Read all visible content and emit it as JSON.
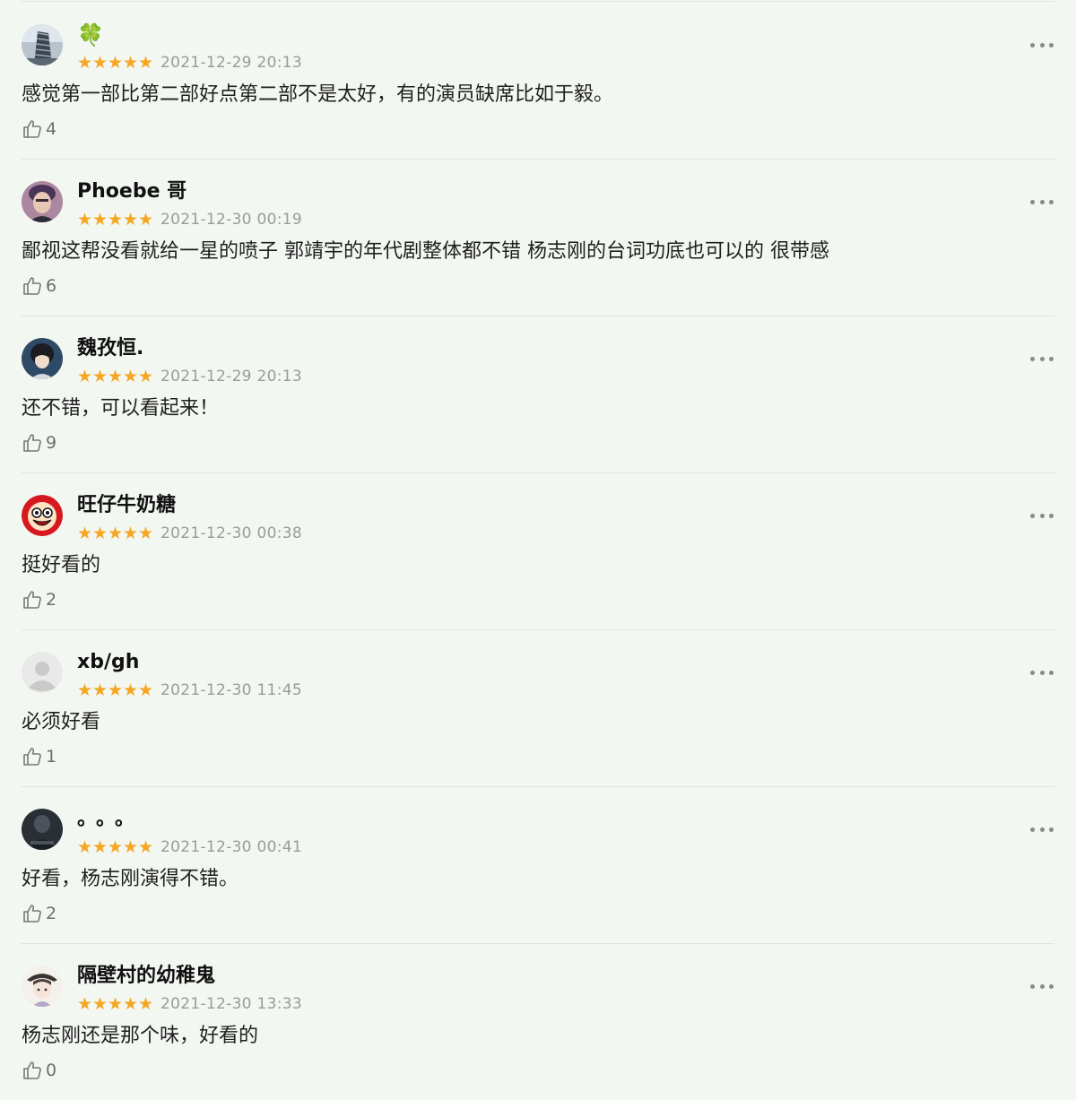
{
  "comments": [
    {
      "username": "🍀",
      "rating": 5,
      "time": "2021-12-29 20:13",
      "text": "感觉第一部比第二部好点第二部不是太好，有的演员缺席比如于毅。",
      "likes": "4"
    },
    {
      "username": "Phoebe 哥",
      "rating": 5,
      "time": "2021-12-30 00:19",
      "text": "鄙视这帮没看就给一星的喷子 郭靖宇的年代剧整体都不错 杨志刚的台词功底也可以的 很带感",
      "likes": "6"
    },
    {
      "username": "魏孜恒.",
      "rating": 5,
      "time": "2021-12-29 20:13",
      "text": "还不错，可以看起来！",
      "likes": "9"
    },
    {
      "username": "旺仔牛奶糖",
      "rating": 5,
      "time": "2021-12-30 00:38",
      "text": "挺好看的",
      "likes": "2"
    },
    {
      "username": "xb/gh",
      "rating": 5,
      "time": "2021-12-30 11:45",
      "text": "必须好看",
      "likes": "1"
    },
    {
      "username": "。。。",
      "rating": 5,
      "time": "2021-12-30 00:41",
      "text": "好看，杨志刚演得不错。",
      "likes": "2"
    },
    {
      "username": "隔壁村的幼稚鬼",
      "rating": 5,
      "time": "2021-12-30 13:33",
      "text": "杨志刚还是那个味，好看的",
      "likes": "0"
    }
  ],
  "icons": {
    "star": "★",
    "like": "thumbs-up-icon",
    "more": "more-horizontal-icon"
  },
  "colors": {
    "background": "#f3f7f2",
    "star": "#f5a623",
    "meta_text": "#9a9a9a",
    "divider": "#dfe5de"
  }
}
